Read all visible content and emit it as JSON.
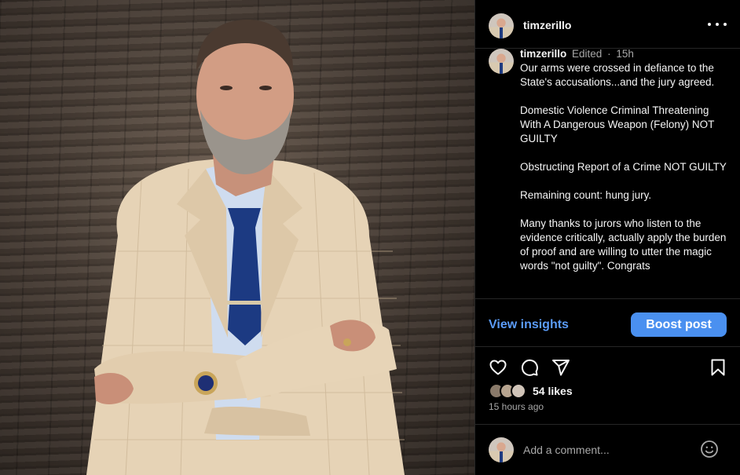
{
  "post": {
    "username": "timzerillo",
    "edited_label": "Edited",
    "separator": "·",
    "time_short": "15h",
    "caption_paragraphs": [
      "Our arms were crossed in defiance to the State's accusations...and the jury agreed.",
      "Domestic Violence Criminal Threatening With A Dangerous Weapon (Felony) NOT GUILTY",
      "Obstructing Report of a Crime NOT GUILTY",
      "Remaining count: hung jury.",
      "Many thanks to jurors who listen to the evidence critically, actually apply the burden of proof and are willing to utter the magic words \"not guilty\". Congrats"
    ],
    "likes_label": "54 likes",
    "time_ago": "15 hours ago"
  },
  "insights": {
    "view_label": "View insights",
    "boost_label": "Boost post"
  },
  "comment": {
    "placeholder": "Add a comment..."
  },
  "icons": {
    "more": "more-horizontal-icon",
    "like": "heart-icon",
    "comment": "comment-icon",
    "share": "send-icon",
    "save": "bookmark-icon",
    "emoji": "emoji-icon"
  },
  "colors": {
    "accent": "#5b9cf8",
    "boost": "#4a90f0",
    "background": "#000000",
    "muted": "#a8a8a8"
  }
}
